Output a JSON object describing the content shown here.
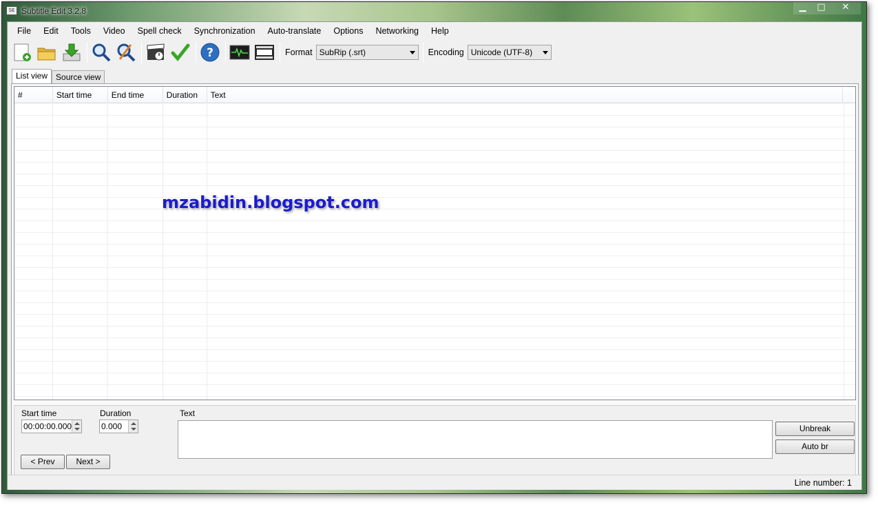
{
  "window": {
    "title": "Subtitle Edit 3.2.8",
    "app_icon": "subtitle-app-icon"
  },
  "caption": {
    "minimize": "▁",
    "maximize": "□",
    "close": "✕"
  },
  "menu": [
    "File",
    "Edit",
    "Tools",
    "Video",
    "Spell check",
    "Synchronization",
    "Auto-translate",
    "Options",
    "Networking",
    "Help"
  ],
  "toolbar": {
    "icons": [
      "new-file-icon",
      "open-folder-icon",
      "download-icon",
      "find-icon",
      "replace-icon",
      "visual-sync-icon",
      "spell-check-icon",
      "help-icon",
      "waveform-icon",
      "video-icon"
    ],
    "format_label": "Format",
    "format_value": "SubRip (.srt)",
    "encoding_label": "Encoding",
    "encoding_value": "Unicode (UTF-8)"
  },
  "tabs": [
    "List view",
    "Source view"
  ],
  "list": {
    "columns": [
      "#",
      "Start time",
      "End time",
      "Duration",
      "Text"
    ]
  },
  "watermark": "mzabidin.blogspot.com",
  "edit": {
    "start_label": "Start time",
    "start_value": "00:00:00.000",
    "duration_label": "Duration",
    "duration_value": "0.000",
    "text_label": "Text",
    "unbreak": "Unbreak",
    "auto_br": "Auto br",
    "prev": "< Prev",
    "next": "Next >"
  },
  "status": {
    "line_number": "Line number: 1"
  },
  "colors": {
    "watermark": "#1b1bd0",
    "check": "#3aa528",
    "help": "#2d6fc0"
  }
}
